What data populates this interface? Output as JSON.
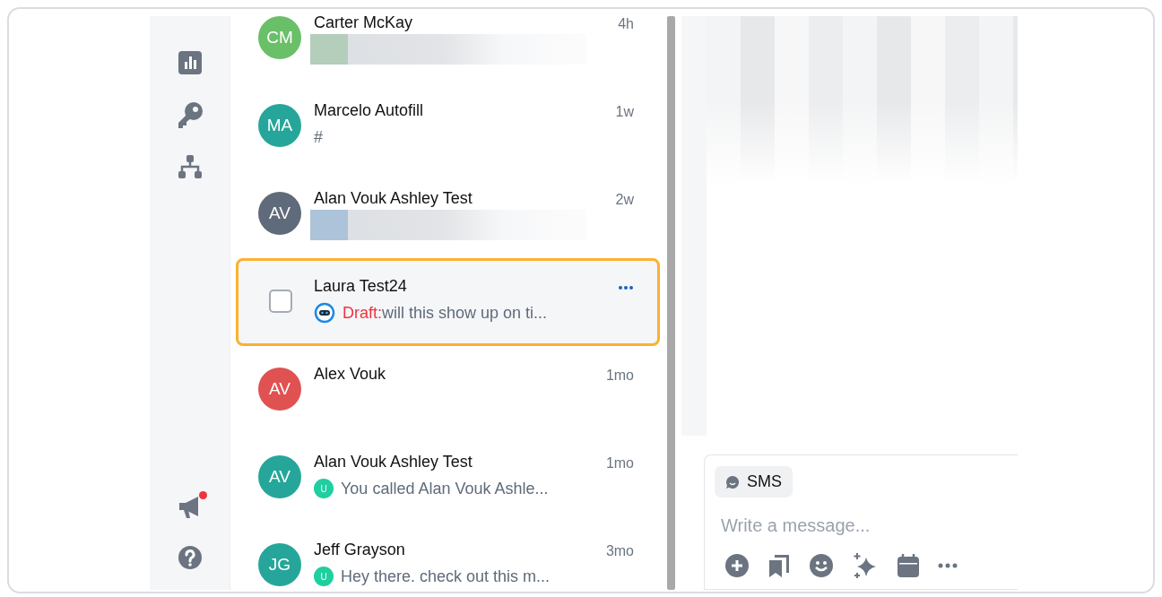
{
  "sidebar": {
    "items": [
      {
        "kind": "chart",
        "badge": false
      },
      {
        "kind": "key",
        "badge": false
      },
      {
        "kind": "hierarchy",
        "badge": false
      }
    ],
    "bottom_items": [
      {
        "kind": "megaphone",
        "badge": true
      },
      {
        "kind": "help",
        "badge": false
      }
    ]
  },
  "conversations": [
    {
      "kind": "avatar",
      "initials": "CM",
      "color": "#6abf69",
      "name": "Carter McKay",
      "time": "4h",
      "preview": {
        "kind": "redacted",
        "color": "#b5cdbb"
      }
    },
    {
      "kind": "avatar",
      "initials": "MA",
      "color": "#26a69a",
      "name": "Marcelo Autofill",
      "time": "1w",
      "preview": {
        "kind": "text",
        "text": "#"
      }
    },
    {
      "kind": "avatar",
      "initials": "AV",
      "color": "#5f6b7a",
      "name": "Alan Vouk Ashley Test",
      "time": "2w",
      "preview": {
        "kind": "redacted",
        "color": "#adc3d9"
      }
    },
    {
      "kind": "checkbox",
      "checked": false,
      "selected": true,
      "name": "Laura Test24",
      "preview": {
        "kind": "draft",
        "label": "Draft:",
        "text": "will this show up on ti..."
      }
    },
    {
      "kind": "avatar",
      "initials": "AV",
      "color": "#e05252",
      "name": "Alex Vouk",
      "time": "1mo"
    },
    {
      "kind": "avatar",
      "initials": "AV",
      "color": "#26a69a",
      "name": "Alan Vouk Ashley Test",
      "time": "1mo",
      "preview": {
        "kind": "user",
        "badge": "U",
        "text": "You called Alan Vouk Ashle..."
      }
    },
    {
      "kind": "avatar",
      "initials": "JG",
      "color": "#26a69a",
      "name": "Jeff Grayson",
      "time": "3mo",
      "preview": {
        "kind": "user",
        "badge": "U",
        "text": "Hey there. check out this m..."
      }
    }
  ],
  "composer": {
    "channel": "SMS",
    "placeholder": "Write a message...",
    "tools": [
      {
        "kind": "add"
      },
      {
        "kind": "bookmarks"
      },
      {
        "kind": "emoji"
      },
      {
        "kind": "sparkle"
      },
      {
        "kind": "calendar"
      },
      {
        "kind": "more"
      }
    ]
  }
}
